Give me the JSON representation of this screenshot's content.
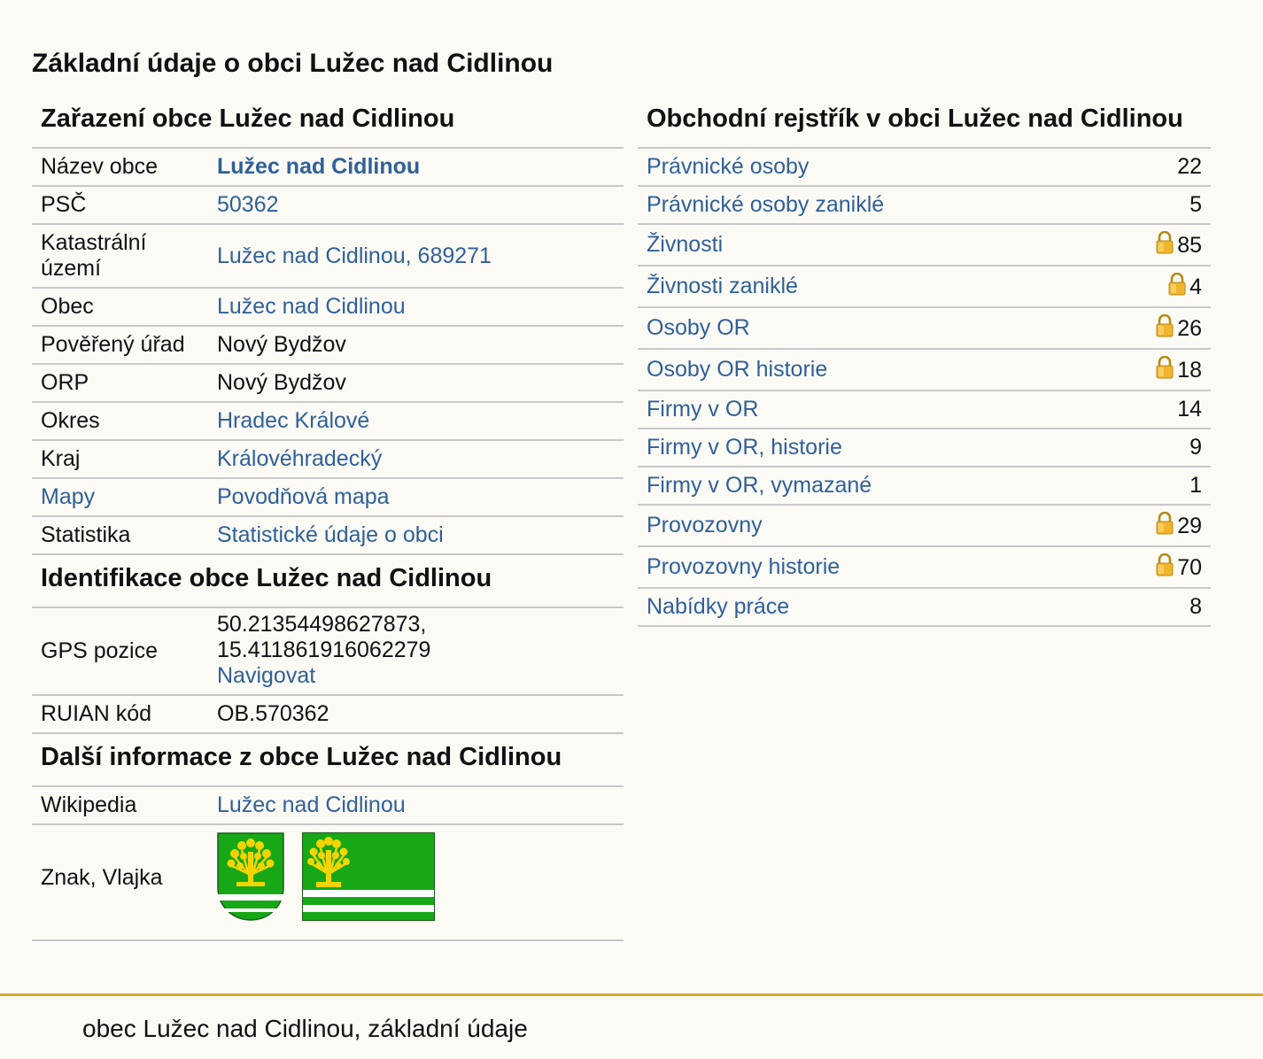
{
  "page_title": "Základní údaje o obci Lužec nad Cidlinou",
  "classification": {
    "heading": "Zařazení obce Lužec nad Cidlinou",
    "rows": [
      {
        "label": "Název obce",
        "value": "Lužec nad Cidlinou",
        "label_link": false,
        "value_link": true,
        "bold": true
      },
      {
        "label": "PSČ",
        "value": "50362",
        "label_link": false,
        "value_link": true,
        "bold": false
      },
      {
        "label": "Katastrální území",
        "value": "Lužec nad Cidlinou, 689271",
        "label_link": false,
        "value_link": true,
        "bold": false
      },
      {
        "label": "Obec",
        "value": "Lužec nad Cidlinou",
        "label_link": false,
        "value_link": true,
        "bold": false
      },
      {
        "label": "Pověřený úřad",
        "value": "Nový Bydžov",
        "label_link": false,
        "value_link": false,
        "bold": false
      },
      {
        "label": "ORP",
        "value": "Nový Bydžov",
        "label_link": false,
        "value_link": false,
        "bold": false
      },
      {
        "label": "Okres",
        "value": "Hradec Králové",
        "label_link": false,
        "value_link": true,
        "bold": false
      },
      {
        "label": "Kraj",
        "value": "Královéhradecký",
        "label_link": false,
        "value_link": true,
        "bold": false
      },
      {
        "label": "Mapy",
        "value": "Povodňová mapa",
        "label_link": true,
        "value_link": true,
        "bold": false
      },
      {
        "label": "Statistika",
        "value": "Statistické údaje o obci",
        "label_link": false,
        "value_link": true,
        "bold": false
      }
    ]
  },
  "identification": {
    "heading": "Identifikace obce Lužec nad Cidlinou",
    "gps_label": "GPS pozice",
    "gps_lat": "50.21354498627873,",
    "gps_lon": "15.411861916062279",
    "navigate_label": "Navigovat",
    "ruian_label": "RUIAN kód",
    "ruian_value": "OB.570362"
  },
  "more_info": {
    "heading": "Další informace z obce Lužec nad Cidlinou",
    "wikipedia_label": "Wikipedia",
    "wikipedia_value": "Lužec nad Cidlinou",
    "emblem_label": "Znak, Vlajka",
    "colors": {
      "green": "#16a816",
      "white": "#ffffff",
      "gold": "#f2d500",
      "stroke": "#1a5e1a"
    }
  },
  "business_register": {
    "heading": "Obchodní rejstřík v obci Lužec nad Cidlinou",
    "rows": [
      {
        "label": "Právnické osoby",
        "count": "22",
        "locked": false
      },
      {
        "label": "Právnické osoby zaniklé",
        "count": "5",
        "locked": false
      },
      {
        "label": "Živnosti",
        "count": "85",
        "locked": true
      },
      {
        "label": "Živnosti zaniklé",
        "count": "4",
        "locked": true
      },
      {
        "label": "Osoby OR",
        "count": "26",
        "locked": true
      },
      {
        "label": "Osoby OR historie",
        "count": "18",
        "locked": true
      },
      {
        "label": "Firmy v OR",
        "count": "14",
        "locked": false
      },
      {
        "label": "Firmy v OR, historie",
        "count": "9",
        "locked": false
      },
      {
        "label": "Firmy v OR, vymazané",
        "count": "1",
        "locked": false
      },
      {
        "label": "Provozovny",
        "count": "29",
        "locked": true
      },
      {
        "label": "Provozovny historie",
        "count": "70",
        "locked": true
      },
      {
        "label": "Nabídky práce",
        "count": "8",
        "locked": false
      }
    ]
  },
  "footer": {
    "text": "obec Lužec nad Cidlinou, základní údaje"
  }
}
